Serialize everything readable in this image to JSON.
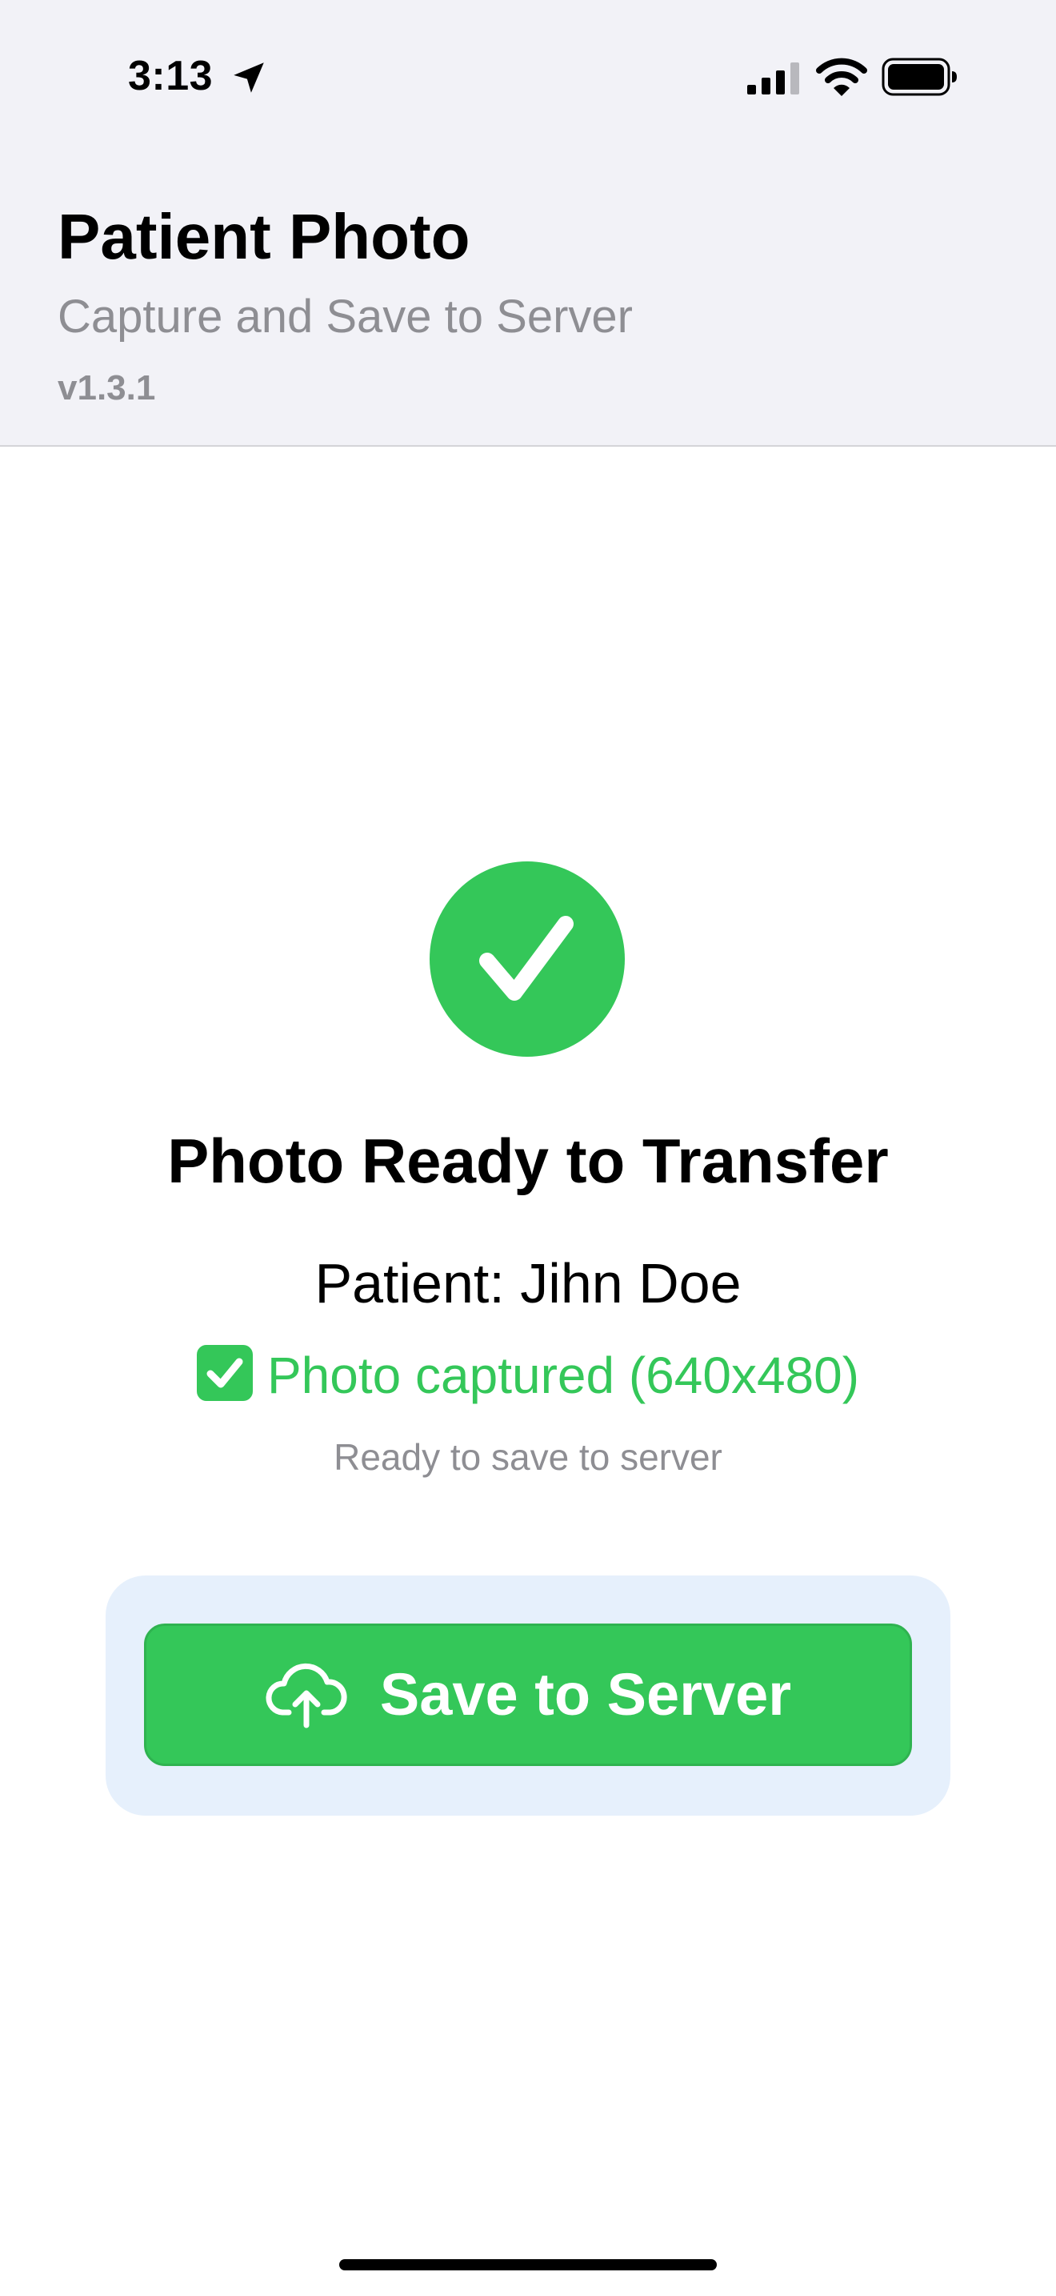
{
  "status_bar": {
    "time": "3:13",
    "icons": [
      "location-arrow-icon",
      "cellular-signal-icon",
      "wifi-icon",
      "battery-icon"
    ]
  },
  "header": {
    "title": "Patient Photo",
    "subtitle": "Capture and Save to Server",
    "version": "v1.3.1",
    "background_color": "#f2f2f7"
  },
  "status": {
    "icon": "checkmark-circle-icon",
    "title": "Photo Ready to Transfer",
    "patient": "Patient: Jihn Doe",
    "capture_icon": "check-box-emoji-icon",
    "capture_text": "Photo captured (640x480)",
    "hint": "Ready to save to server"
  },
  "actions": {
    "save_label": "Save to Server",
    "save_icon": "cloud-upload-icon"
  },
  "colors": {
    "accent_green": "#34c759",
    "secondary_text": "#8e8e93",
    "button_container": "#e6f0fc"
  }
}
